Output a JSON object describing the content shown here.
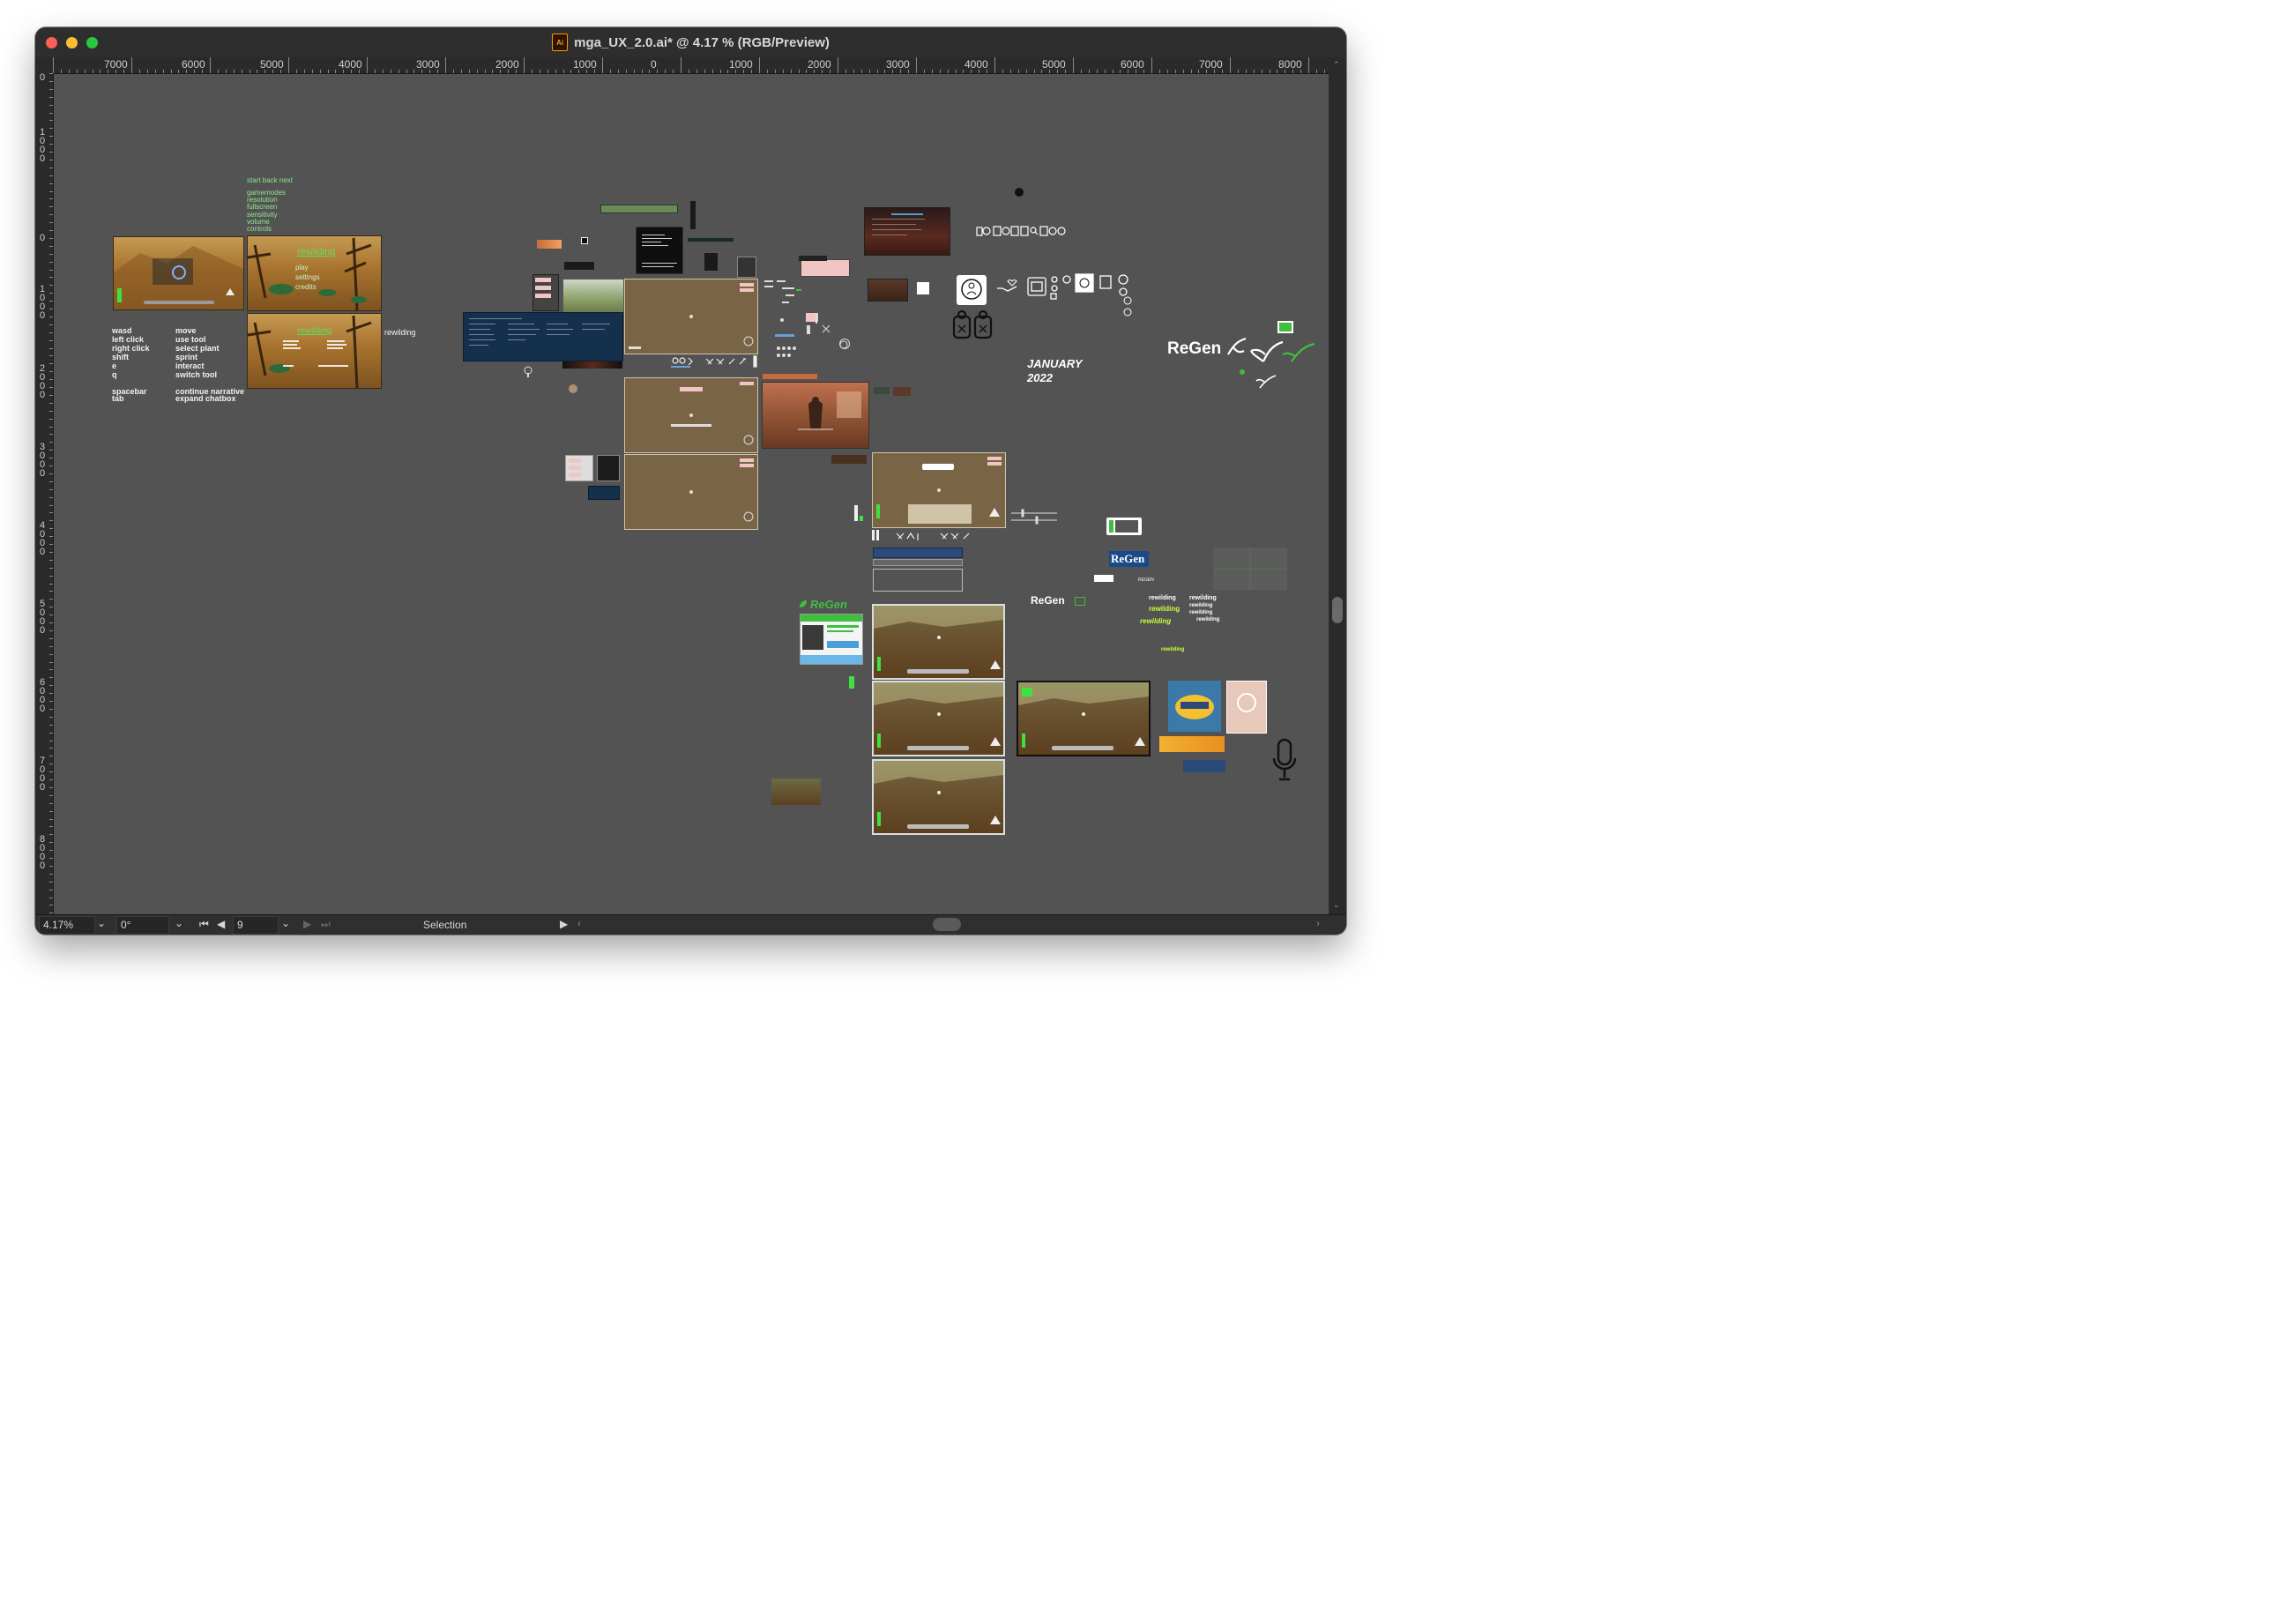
{
  "window": {
    "title": "mga_UX_2.0.ai* @ 4.17 % (RGB/Preview)",
    "app_icon_text": "Ai"
  },
  "ruler": {
    "top_labels": [
      "7000",
      "6000",
      "5000",
      "4000",
      "3000",
      "2000",
      "1000",
      "0",
      "1000",
      "2000",
      "3000",
      "4000",
      "5000",
      "6000",
      "7000",
      "8000"
    ],
    "left_labels": [
      "0",
      "1000",
      "0",
      "1000",
      "2000",
      "3000",
      "4000",
      "5000",
      "6000",
      "7000",
      "8000"
    ]
  },
  "artboards": {
    "menu_options_top": "start  back  next",
    "menu_options_list": [
      "gamemodes",
      "resolution",
      "fullscreen",
      "sensitivity",
      "volume",
      "controls"
    ],
    "title_card": {
      "logo": "rewilding",
      "items": [
        "play",
        "settings",
        "credits"
      ]
    },
    "controls_card_logo": "rewilding",
    "side_label": "rewilding",
    "controls": {
      "keys": [
        "wasd",
        "left click",
        "right click",
        "shift",
        "e",
        "q",
        "",
        "spacebar",
        "tab"
      ],
      "actions": [
        "move",
        "use tool",
        "select plant",
        "sprint",
        "interact",
        "switch tool",
        "",
        "continue narrative",
        "expand chatbox"
      ]
    },
    "january_label": "JANUARY",
    "year_label": "2022",
    "regen_logo_large": "ReGen",
    "regen_logo_small": "ReGen",
    "regen_logo_green": "ReGen",
    "regen_badge": "ReGen",
    "regen_small_caps": "REGEN",
    "rewilding_words": [
      "rewilding",
      "rewilding",
      "rewilding",
      "rewilding",
      "rewilding",
      "rewilding",
      "rewilding",
      "rewilding"
    ]
  },
  "status": {
    "zoom": "4.17%",
    "rotation": "0°",
    "artboard_number": "9",
    "tool": "Selection"
  },
  "colors": {
    "canvas": "#535353",
    "chrome": "#2e2e2e",
    "accent_green": "#3fbf3f",
    "sand": "#a7722d"
  }
}
